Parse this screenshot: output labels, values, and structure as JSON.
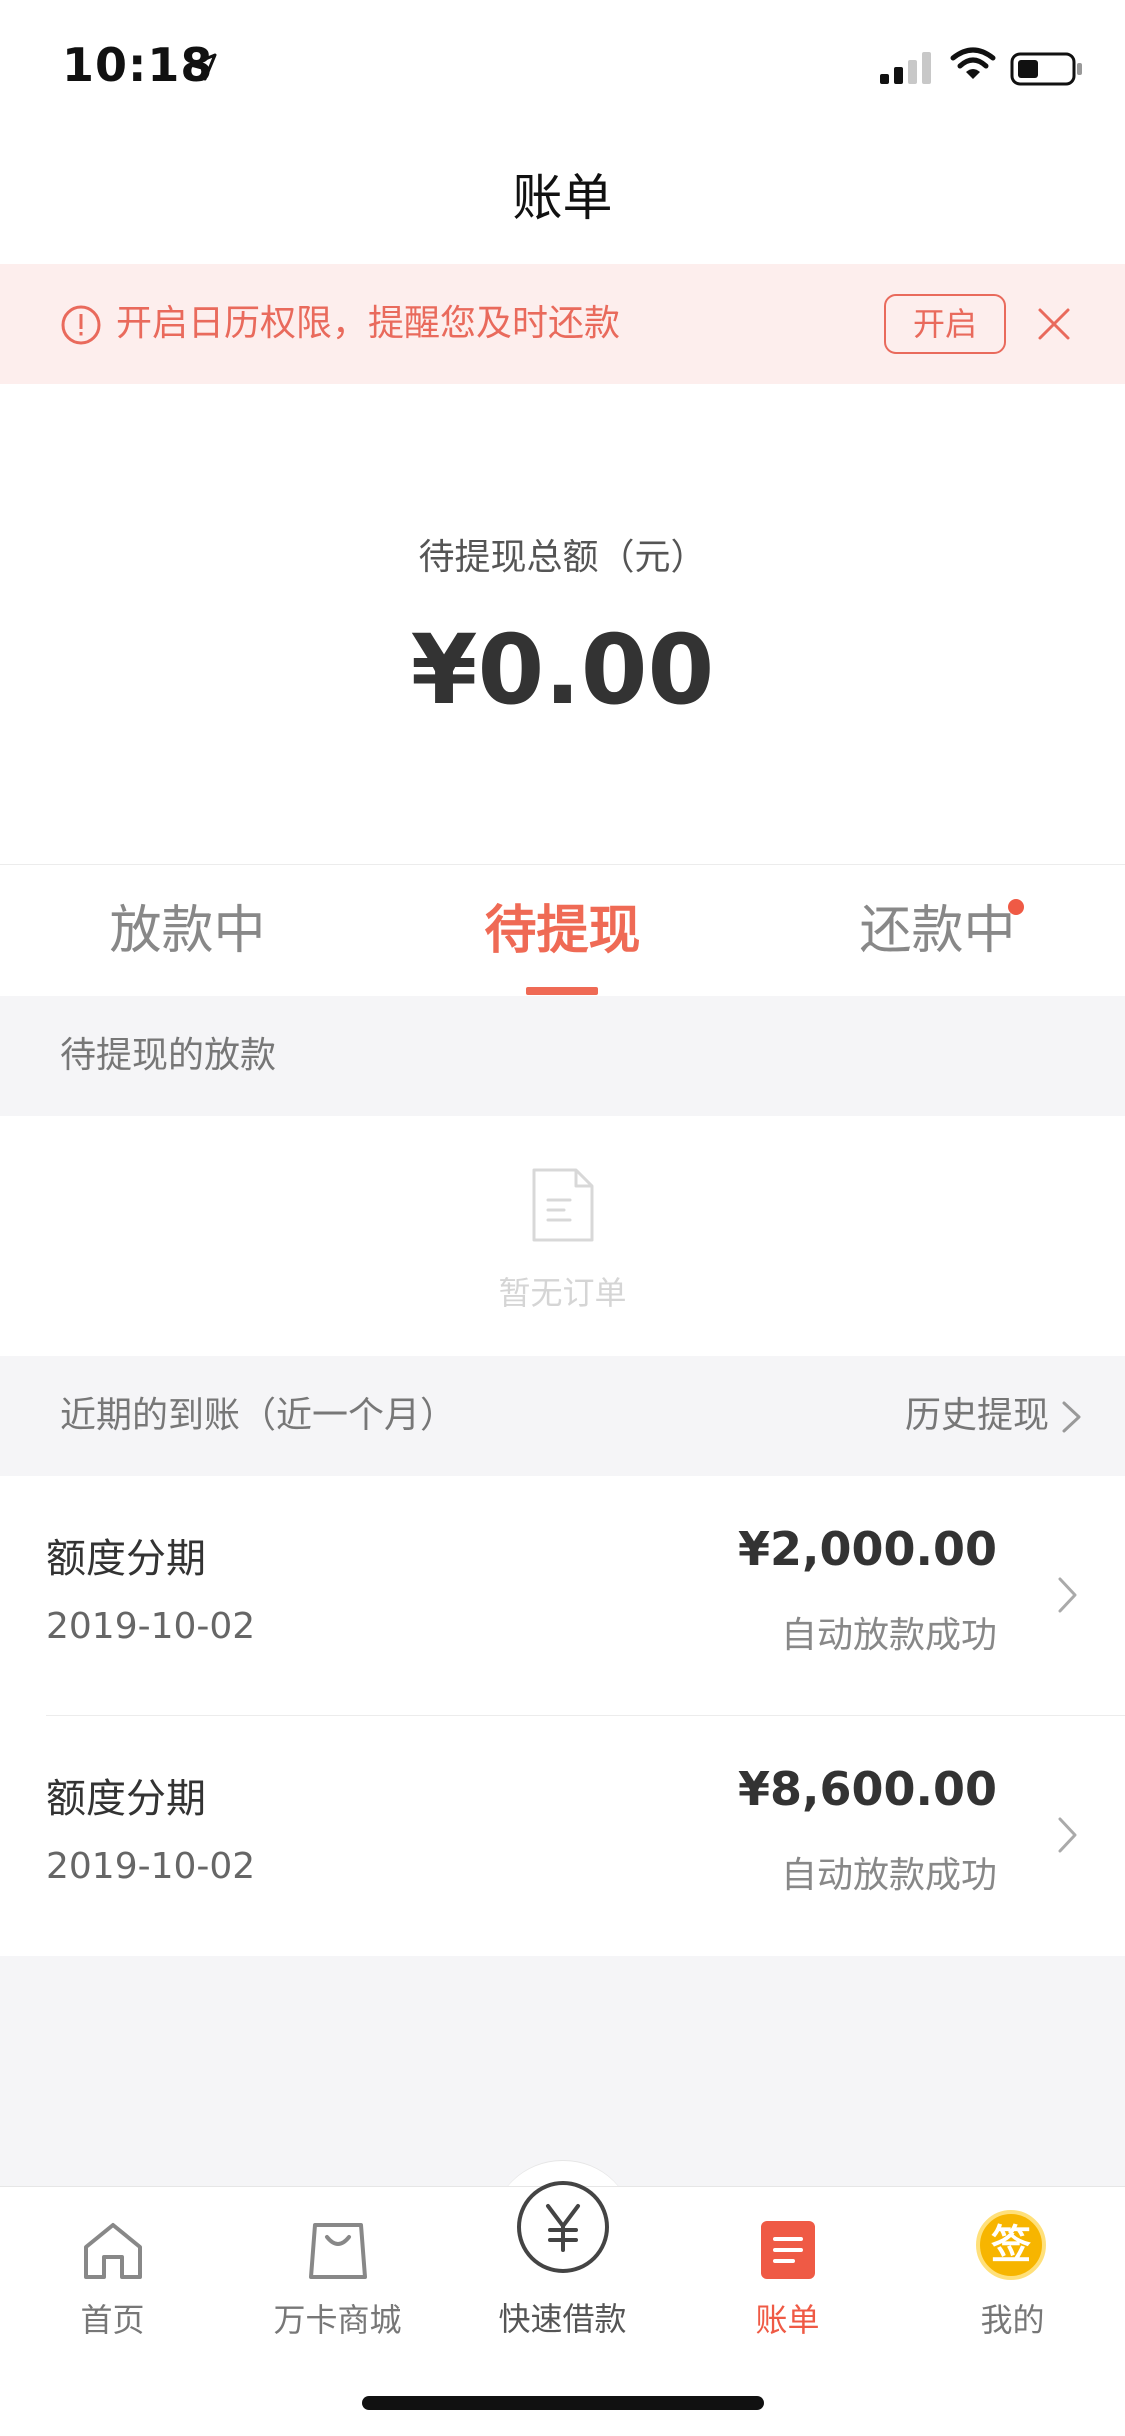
{
  "status_bar": {
    "time": "10:18"
  },
  "header": {
    "title": "账单"
  },
  "banner": {
    "message": "开启日历权限，提醒您及时还款",
    "open_label": "开启"
  },
  "summary": {
    "label": "待提现总额（元）",
    "amount": "¥0.00"
  },
  "tabs": [
    {
      "label": "放款中"
    },
    {
      "label": "待提现",
      "active": true
    },
    {
      "label": "还款中",
      "has_dot": true
    }
  ],
  "pending_section": {
    "title": "待提现的放款",
    "empty_text": "暂无订单"
  },
  "recent_section": {
    "title": "近期的到账（近一个月）",
    "history_label": "历史提现"
  },
  "records": [
    {
      "title": "额度分期",
      "date": "2019-10-02",
      "amount": "¥2,000.00",
      "status": "自动放款成功"
    },
    {
      "title": "额度分期",
      "date": "2019-10-02",
      "amount": "¥8,600.00",
      "status": "自动放款成功"
    }
  ],
  "tabbar": {
    "items": [
      {
        "label": "首页",
        "icon": "home-icon"
      },
      {
        "label": "万卡商城",
        "icon": "shopping-bag-icon"
      },
      {
        "label": "快速借款",
        "icon": "yen-circle-icon"
      },
      {
        "label": "账单",
        "icon": "bill-icon",
        "active": true
      },
      {
        "label": "我的",
        "icon": "sign-in-badge-icon",
        "badge_text": "签"
      }
    ]
  },
  "colors": {
    "accent": "#ef6a55",
    "banner_bg": "#fdeeed",
    "banner_text": "#e96a5c"
  }
}
